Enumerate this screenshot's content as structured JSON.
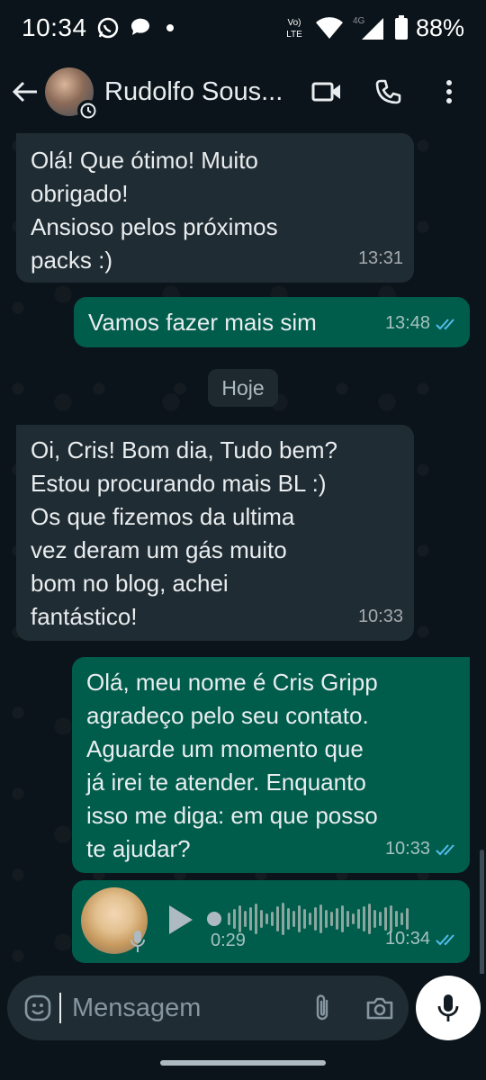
{
  "status_bar": {
    "time": "10:34",
    "network_label_top": "Vo)",
    "network_label_bottom": "LTE",
    "network_type": "4G",
    "battery": "88%"
  },
  "header": {
    "contact_name": "Rudolfo Sous...",
    "icons": [
      "back-arrow-icon",
      "video-call-icon",
      "voice-call-icon",
      "more-options-icon"
    ]
  },
  "messages": [
    {
      "direction": "in",
      "text": "Olá! Que ótimo! Muito\nobrigado!\nAnsioso pelos próximos\npacks :)",
      "time": "13:31"
    },
    {
      "direction": "out",
      "text": "Vamos fazer mais sim",
      "time": "13:48",
      "status": "read"
    },
    {
      "direction": "in",
      "text": "Oi, Cris! Bom dia, Tudo bem?\nEstou procurando mais BL :)\nOs que fizemos da ultima\nvez deram um gás muito\nbom no blog, achei\nfantástico!",
      "time": "10:33"
    },
    {
      "direction": "out",
      "text": "Olá, meu nome é Cris Gripp\nagradeço pelo seu contato.\nAguarde um momento que\njá irei te atender. Enquanto\nisso me diga: em que posso\nte ajudar?",
      "time": "10:33",
      "status": "read"
    }
  ],
  "day_divider": "Hoje",
  "voice_message": {
    "duration": "0:29",
    "time": "10:34",
    "status": "read",
    "progress": 0
  },
  "composer": {
    "placeholder": "Mensagem"
  },
  "colors": {
    "background": "#0b141a",
    "incoming_bubble": "#202c33",
    "outgoing_bubble": "#005c4b",
    "read_ticks": "#53bdeb"
  }
}
